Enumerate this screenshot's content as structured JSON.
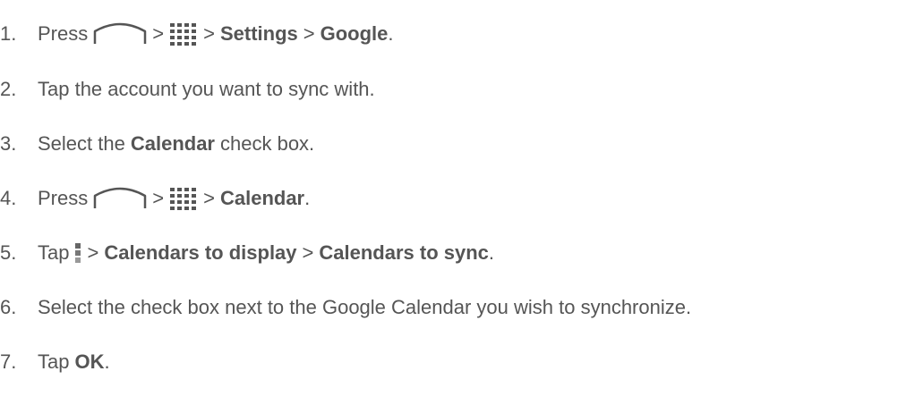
{
  "steps": [
    {
      "number": "1.",
      "text_press": "Press",
      "icons": [
        "home-icon",
        "apps-icon"
      ],
      "sep1": ">",
      "sep2": ">",
      "bold1": "Settings",
      "sep3": ">",
      "bold2": "Google",
      "end": "."
    },
    {
      "number": "2.",
      "text": "Tap the account you want to sync with."
    },
    {
      "number": "3.",
      "pre": "Select the",
      "bold": "Calendar",
      "post": "check box."
    },
    {
      "number": "4.",
      "text_press": "Press",
      "icons": [
        "home-icon",
        "apps-icon"
      ],
      "sep1": ">",
      "sep2": ">",
      "bold": "Calendar",
      "end": "."
    },
    {
      "number": "5.",
      "pre": "Tap",
      "icons": [
        "menu-icon"
      ],
      "sep1": ">",
      "bold1": "Calendars to display",
      "sep2": ">",
      "bold2": "Calendars to sync",
      "end": "."
    },
    {
      "number": "6.",
      "text": "Select the check box next to the Google Calendar you wish to synchronize."
    },
    {
      "number": "7.",
      "pre": "Tap",
      "bold": "OK",
      "end": "."
    }
  ]
}
